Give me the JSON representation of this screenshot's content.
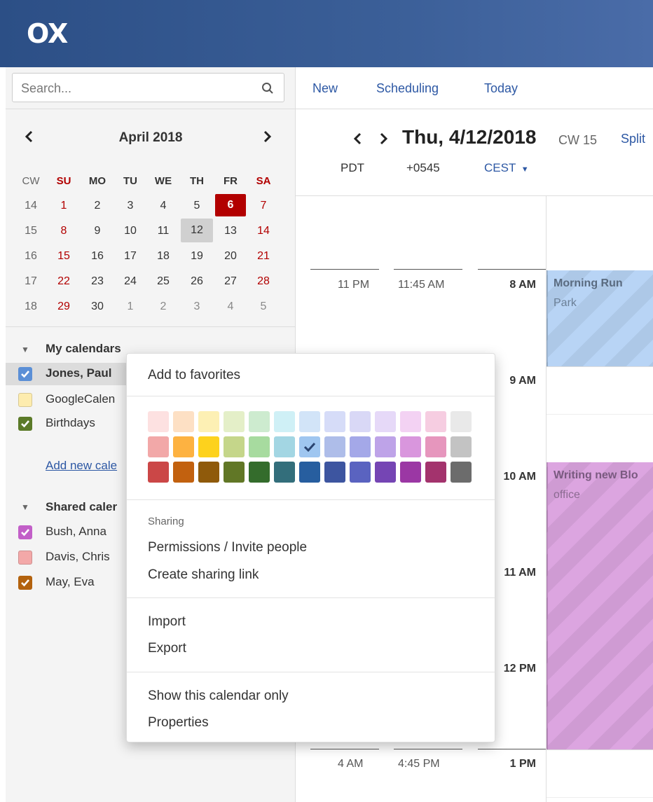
{
  "app": {
    "logo": "OX"
  },
  "search": {
    "placeholder": "Search..."
  },
  "toolbar": {
    "new": "New",
    "scheduling": "Scheduling",
    "today": "Today"
  },
  "minical": {
    "title": "April 2018",
    "prev_icon": "chevron-left-icon",
    "next_icon": "chevron-right-icon",
    "headers": [
      "CW",
      "SU",
      "MO",
      "TU",
      "WE",
      "TH",
      "FR",
      "SA"
    ],
    "rows": [
      [
        "14",
        "1",
        "2",
        "3",
        "4",
        "5",
        "6",
        "7"
      ],
      [
        "15",
        "8",
        "9",
        "10",
        "11",
        "12",
        "13",
        "14"
      ],
      [
        "16",
        "15",
        "16",
        "17",
        "18",
        "19",
        "20",
        "21"
      ],
      [
        "17",
        "22",
        "23",
        "24",
        "25",
        "26",
        "27",
        "28"
      ],
      [
        "18",
        "29",
        "30",
        "1",
        "2",
        "3",
        "4",
        "5"
      ]
    ],
    "today": "6",
    "selected": "12"
  },
  "my_calendars": {
    "title": "My calendars",
    "items": [
      {
        "label": "Jones, Paul",
        "checked": true,
        "color": "#5b8fd6"
      },
      {
        "label": "GoogleCalen",
        "checked": false,
        "color": "#fdecae"
      },
      {
        "label": "Birthdays",
        "checked": true,
        "color": "#5b7a28"
      }
    ],
    "add_link": "Add new cale"
  },
  "shared_calendars": {
    "title": "Shared caler",
    "items": [
      {
        "label": "Bush, Anna",
        "checked": true,
        "color": "#c25fc8"
      },
      {
        "label": "Davis, Chris",
        "checked": false,
        "color": "#f3a8a8"
      },
      {
        "label": "May, Eva",
        "checked": true,
        "color": "#b3620e"
      }
    ]
  },
  "calendar_header": {
    "date": "Thu, 4/12/2018",
    "cw": "CW 15",
    "split": "Split",
    "timezones": [
      "PDT",
      "+0545",
      "CEST"
    ]
  },
  "time_rows": [
    {
      "pdt": "11 PM",
      "np": "11:45 AM",
      "cest": "8 AM"
    },
    {
      "pdt": "",
      "np": "",
      "cest": "9 AM"
    },
    {
      "pdt": "",
      "np": "",
      "cest": "10 AM"
    },
    {
      "pdt": "",
      "np": "",
      "cest": "11 AM"
    },
    {
      "pdt": "",
      "np": "",
      "cest": "12 PM"
    },
    {
      "pdt": "4 AM",
      "np": "4:45 PM",
      "cest": "1 PM"
    }
  ],
  "events": [
    {
      "title": "Morning Run",
      "location": "Park",
      "color": "#b8d4f5"
    },
    {
      "title": "Writing new Blo",
      "location": "office",
      "color": "#dca5e0"
    }
  ],
  "context_menu": {
    "add_favorites": "Add to favorites",
    "colors": [
      [
        "#fde1e1",
        "#fde0c4",
        "#fdf0b4",
        "#e4efc8",
        "#cdebcf",
        "#cff0f6",
        "#d2e4f8",
        "#d6dcf8",
        "#d9d8f6",
        "#e6d9f8",
        "#f3d2f3",
        "#f6cde1",
        "#e9e9e9"
      ],
      [
        "#f2a8a8",
        "#fdb241",
        "#fdd21d",
        "#c5d68a",
        "#a7db9f",
        "#a3d6e3",
        "#9fc6f0",
        "#aebde9",
        "#a4a8e8",
        "#bea3e8",
        "#d996dd",
        "#e696bd",
        "#c3c3c3"
      ],
      [
        "#cb4747",
        "#c2610f",
        "#8f5a0b",
        "#617726",
        "#346c2c",
        "#336e7b",
        "#275e9f",
        "#3d55a0",
        "#5a63c0",
        "#7545b4",
        "#9b37a4",
        "#a3336d",
        "#6c6c6c"
      ]
    ],
    "selected_color": "#9fc6f0",
    "sharing_header": "Sharing",
    "permissions": "Permissions / Invite people",
    "create_link": "Create sharing link",
    "import": "Import",
    "export": "Export",
    "show_only": "Show this calendar only",
    "properties": "Properties"
  }
}
